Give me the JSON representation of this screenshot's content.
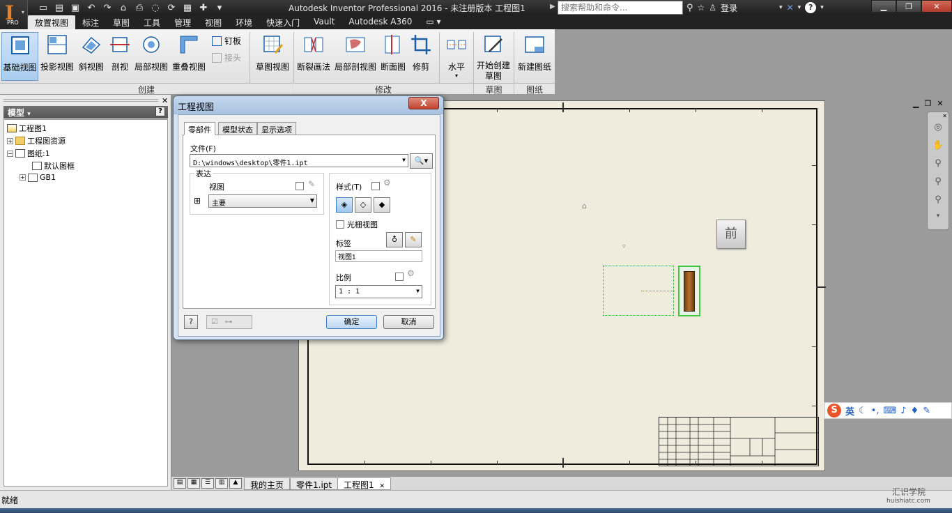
{
  "titlebar": {
    "title": "Autodesk Inventor Professional 2016 - 未注册版本   工程图1",
    "search_placeholder": "搜索帮助和命令...",
    "login_label": "登录",
    "logo_badge": "PRO"
  },
  "menu_tabs": [
    "放置视图",
    "标注",
    "草图",
    "工具",
    "管理",
    "视图",
    "环境",
    "快速入门",
    "Vault",
    "Autodesk A360"
  ],
  "ribbon": {
    "create_buttons": [
      "基础视图",
      "投影视图",
      "斜视图",
      "剖视",
      "局部视图",
      "重叠视图"
    ],
    "create_small": [
      "钉板",
      "接头"
    ],
    "sketch_view": "草图视图",
    "modify_buttons": [
      "断裂画法",
      "局部剖视图",
      "断面图",
      "修剪"
    ],
    "align_button": "水平",
    "sketch_button": "开始创建草图",
    "sheet_button": "新建图纸",
    "panels": [
      "创建",
      "修改",
      "草图",
      "图纸"
    ]
  },
  "browser": {
    "header": "模型",
    "help": "?",
    "tree": [
      "工程图1",
      "工程图资源",
      "图纸:1",
      "默认图框",
      "GB1"
    ]
  },
  "viewcube_label": "前",
  "doc_tabs": [
    "我的主页",
    "零件1.ipt",
    "工程图1"
  ],
  "status_text": "就绪",
  "watermark": {
    "main": "汇识学院",
    "sub": "huishiatc.com"
  },
  "ime": {
    "lang": "英"
  },
  "dialog": {
    "title": "工程视图",
    "close": "X",
    "tabs": [
      "零部件",
      "模型状态",
      "显示选项"
    ],
    "file_label": "文件(F)",
    "file_value": "D:\\windows\\desktop\\零件1.ipt",
    "representation_label": "表达",
    "view_label": "视图",
    "view_value": "主要",
    "style_label": "样式(T)",
    "raster_label": "光栅视图",
    "label_label": "标签",
    "label_value": "视图1",
    "scale_label": "比例",
    "scale_value": "1 : 1",
    "ok": "确定",
    "cancel": "取消",
    "help": "?"
  }
}
